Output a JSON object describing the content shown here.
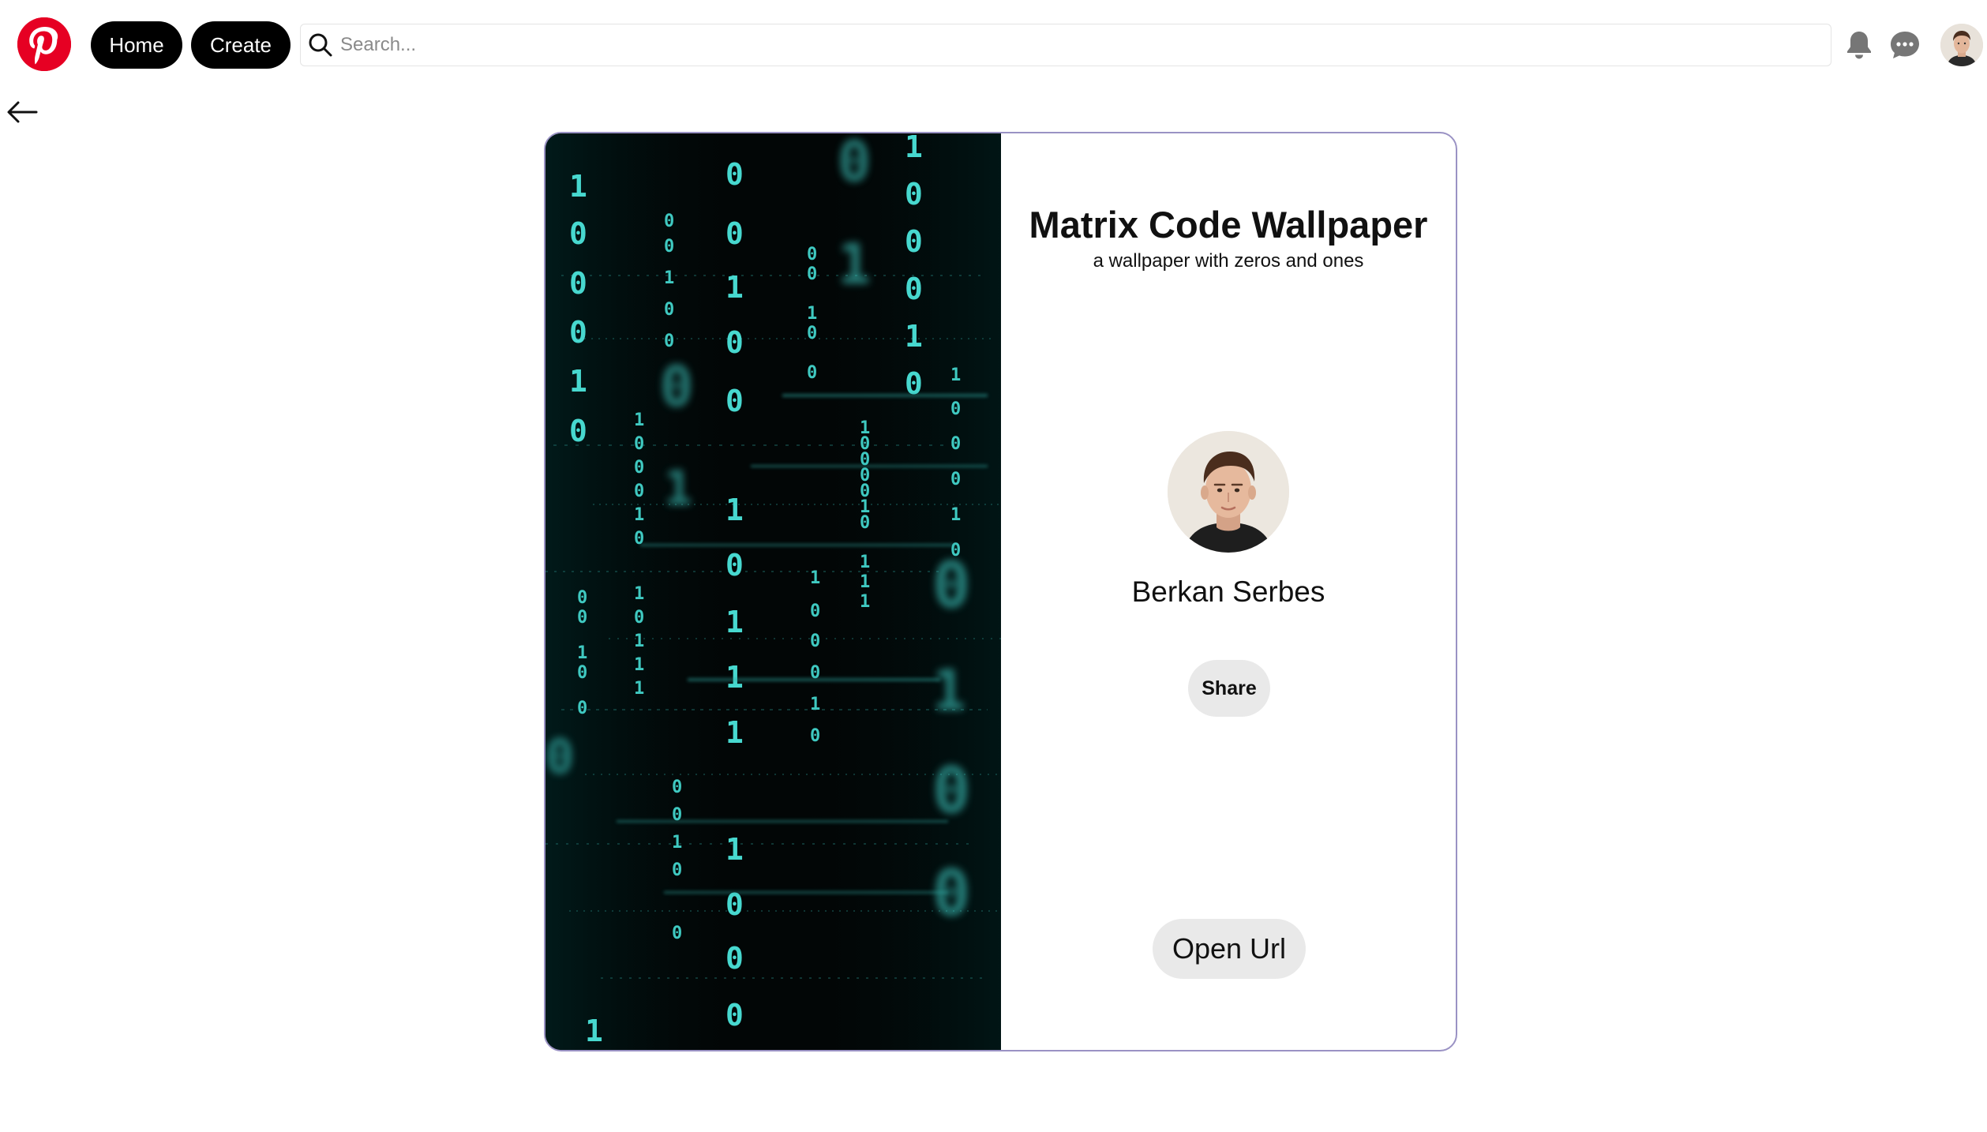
{
  "header": {
    "logo_icon": "pinterest-logo-icon",
    "home_label": "Home",
    "create_label": "Create",
    "search": {
      "placeholder": "Search...",
      "value": ""
    },
    "notifications_icon": "bell-icon",
    "messages_icon": "chat-bubble-icon",
    "profile_icon": "user-avatar"
  },
  "navigation": {
    "back_icon": "arrow-left-icon"
  },
  "pin": {
    "image_icon": "matrix-code-image",
    "title": "Matrix Code Wallpaper",
    "description": "a wallpaper with zeros and ones",
    "author": {
      "name": "Berkan Serbes",
      "avatar_icon": "author-avatar"
    },
    "share_label": "Share",
    "open_url_label": "Open Url"
  },
  "colors": {
    "brand": "#e60023",
    "matrix_glyph": "#3fd0c8",
    "card_border": "#9a92c4",
    "button_bg": "#e9e9e9"
  }
}
